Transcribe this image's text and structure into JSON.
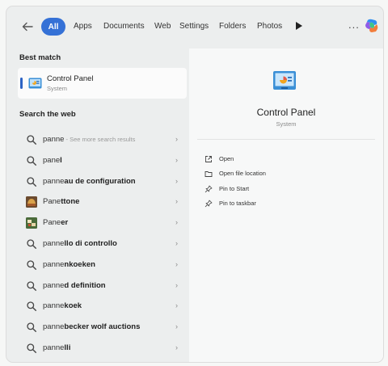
{
  "filters": {
    "all": "All",
    "tabs": [
      "Apps",
      "Documents",
      "Web",
      "Settings",
      "Folders",
      "Photos"
    ],
    "more": "..."
  },
  "best_match": {
    "heading": "Best match",
    "name": "Control Panel",
    "type": "System"
  },
  "web": {
    "heading": "Search the web",
    "rows": [
      {
        "typed": "panne",
        "rest": "",
        "hint": " - See more search results",
        "icon": "search-icon"
      },
      {
        "typed": "pane",
        "rest": "l",
        "hint": "",
        "icon": "search-icon"
      },
      {
        "typed": "panne",
        "rest": "au de configuration",
        "hint": "",
        "icon": "search-icon"
      },
      {
        "typed": "Pane",
        "rest": "ttone",
        "hint": "",
        "icon": "panettone-image"
      },
      {
        "typed": "Pane",
        "rest": "er",
        "hint": "",
        "icon": "paneer-image"
      },
      {
        "typed": "panne",
        "rest": "llo di controllo",
        "hint": "",
        "icon": "search-icon"
      },
      {
        "typed": "panne",
        "rest": "nkoeken",
        "hint": "",
        "icon": "search-icon"
      },
      {
        "typed": "panne",
        "rest": "d definition",
        "hint": "",
        "icon": "search-icon"
      },
      {
        "typed": "panne",
        "rest": "koek",
        "hint": "",
        "icon": "search-icon"
      },
      {
        "typed": "panne",
        "rest": "becker wolf auctions",
        "hint": "",
        "icon": "search-icon"
      },
      {
        "typed": "panne",
        "rest": "lli",
        "hint": "",
        "icon": "search-icon"
      }
    ]
  },
  "preview": {
    "title": "Control Panel",
    "subtitle": "System",
    "actions": [
      {
        "label": "Open",
        "icon": "open-icon"
      },
      {
        "label": "Open file location",
        "icon": "folder-icon"
      },
      {
        "label": "Pin to Start",
        "icon": "pin-icon"
      },
      {
        "label": "Pin to taskbar",
        "icon": "pin-icon"
      }
    ]
  },
  "colors": {
    "accent": "#3571d6",
    "panel_left": "#eceeee",
    "panel_right": "#f7f8f8"
  }
}
